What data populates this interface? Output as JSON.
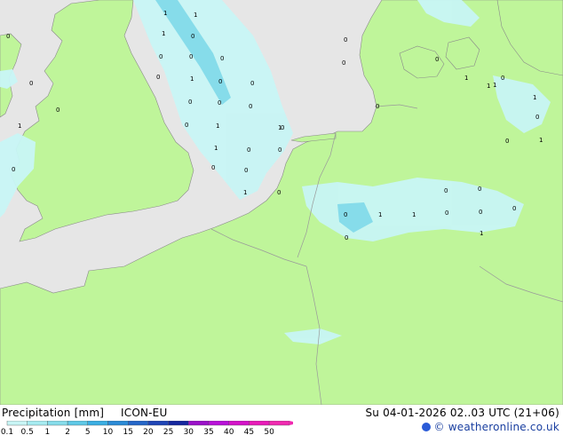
{
  "legend": {
    "title": "Precipitation [mm]",
    "model": "ICON-EU",
    "ticks": [
      "0.1",
      "0.5",
      "1",
      "2",
      "5",
      "10",
      "15",
      "20",
      "25",
      "30",
      "35",
      "40",
      "45",
      "50"
    ],
    "colors": [
      "#c8f5f5",
      "#a6ebf0",
      "#86dcea",
      "#5ec8e6",
      "#3aaee2",
      "#2a8ad6",
      "#2466c8",
      "#1e44b6",
      "#14269e",
      "#9a10c8",
      "#b810d8",
      "#d412c8",
      "#e81ab8",
      "#f02ab0"
    ]
  },
  "valid_time": "Su 04-01-2026 02..03 UTC (21+06)",
  "credit": "© weatheronline.co.uk",
  "map": {
    "land_color": "#bff59a",
    "sea_color": "#e6e6e6",
    "rain_color": "#c8f5f5",
    "point_labels": [
      {
        "id": "p1",
        "text": "1"
      },
      {
        "id": "p2",
        "text": "1"
      },
      {
        "id": "p3",
        "text": "1"
      },
      {
        "id": "p4",
        "text": "0"
      },
      {
        "id": "p5",
        "text": "0"
      },
      {
        "id": "p6",
        "text": "0"
      },
      {
        "id": "p7",
        "text": "0"
      },
      {
        "id": "p8",
        "text": "0"
      },
      {
        "id": "p9",
        "text": "1"
      },
      {
        "id": "p10",
        "text": "0"
      },
      {
        "id": "p11",
        "text": "0"
      },
      {
        "id": "p12",
        "text": "0"
      },
      {
        "id": "p13",
        "text": "0"
      },
      {
        "id": "p14",
        "text": "0"
      },
      {
        "id": "p15",
        "text": "1"
      },
      {
        "id": "p16",
        "text": "0"
      },
      {
        "id": "p17",
        "text": "0"
      },
      {
        "id": "p18",
        "text": "1"
      },
      {
        "id": "p19",
        "text": "0"
      },
      {
        "id": "p20",
        "text": "1"
      },
      {
        "id": "p21",
        "text": "0"
      },
      {
        "id": "p22",
        "text": "0"
      },
      {
        "id": "p23",
        "text": "0"
      },
      {
        "id": "p24",
        "text": "1"
      },
      {
        "id": "p25",
        "text": "0"
      },
      {
        "id": "p26",
        "text": "0"
      },
      {
        "id": "p27",
        "text": "0"
      },
      {
        "id": "p28",
        "text": "1"
      },
      {
        "id": "p29",
        "text": "0"
      },
      {
        "id": "p30",
        "text": "0"
      },
      {
        "id": "p31",
        "text": "0"
      },
      {
        "id": "p32",
        "text": "1"
      },
      {
        "id": "p33",
        "text": "1"
      },
      {
        "id": "p34",
        "text": "0"
      },
      {
        "id": "p35",
        "text": "0"
      },
      {
        "id": "p36",
        "text": "0"
      },
      {
        "id": "p37",
        "text": "0"
      },
      {
        "id": "p38",
        "text": "0"
      },
      {
        "id": "p39",
        "text": "0"
      },
      {
        "id": "p40",
        "text": "0"
      },
      {
        "id": "p41",
        "text": "1"
      },
      {
        "id": "p42",
        "text": "0"
      },
      {
        "id": "p43",
        "text": "1"
      },
      {
        "id": "p44",
        "text": "0"
      },
      {
        "id": "p45",
        "text": "0"
      },
      {
        "id": "p46",
        "text": "0"
      },
      {
        "id": "p47",
        "text": "1"
      },
      {
        "id": "p48",
        "text": "0"
      },
      {
        "id": "p49",
        "text": "1"
      },
      {
        "id": "p50",
        "text": "1"
      },
      {
        "id": "p51",
        "text": "0"
      }
    ]
  }
}
